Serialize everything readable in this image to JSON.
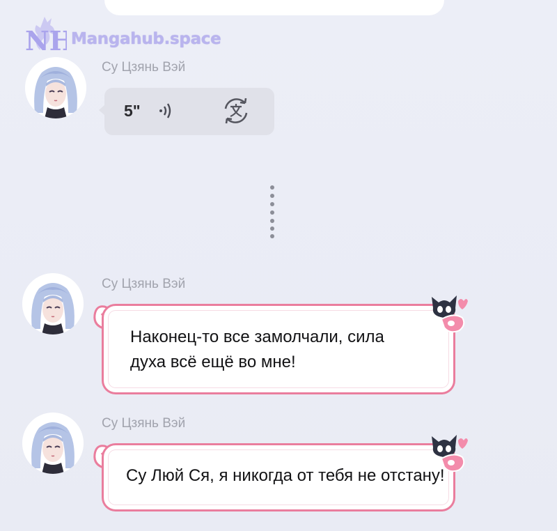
{
  "watermark": {
    "logo": "NH",
    "site": "Mangahub.space"
  },
  "chat": {
    "voice_message": {
      "sender": "Су Цзянь Вэй",
      "duration": "5\"",
      "sound_icon": "sound-wave-icon",
      "translate_icon": "translate-icon"
    },
    "messages": [
      {
        "sender": "Су Цзянь Вэй",
        "lines": [
          "Наконец-то все замолчали, сила",
          "духа всё ещё во мне!"
        ]
      },
      {
        "sender": "Су Цзянь Вэй",
        "lines": [
          "Су Люй Ся, я никогда от тебя не отстану!"
        ]
      }
    ]
  },
  "colors": {
    "background": "#eceef6",
    "bubble_border": "#ea7d9d",
    "watermark": "#b9b4ee",
    "sender_text": "#a1a3ad",
    "voice_bubble": "#e0e1e9"
  }
}
